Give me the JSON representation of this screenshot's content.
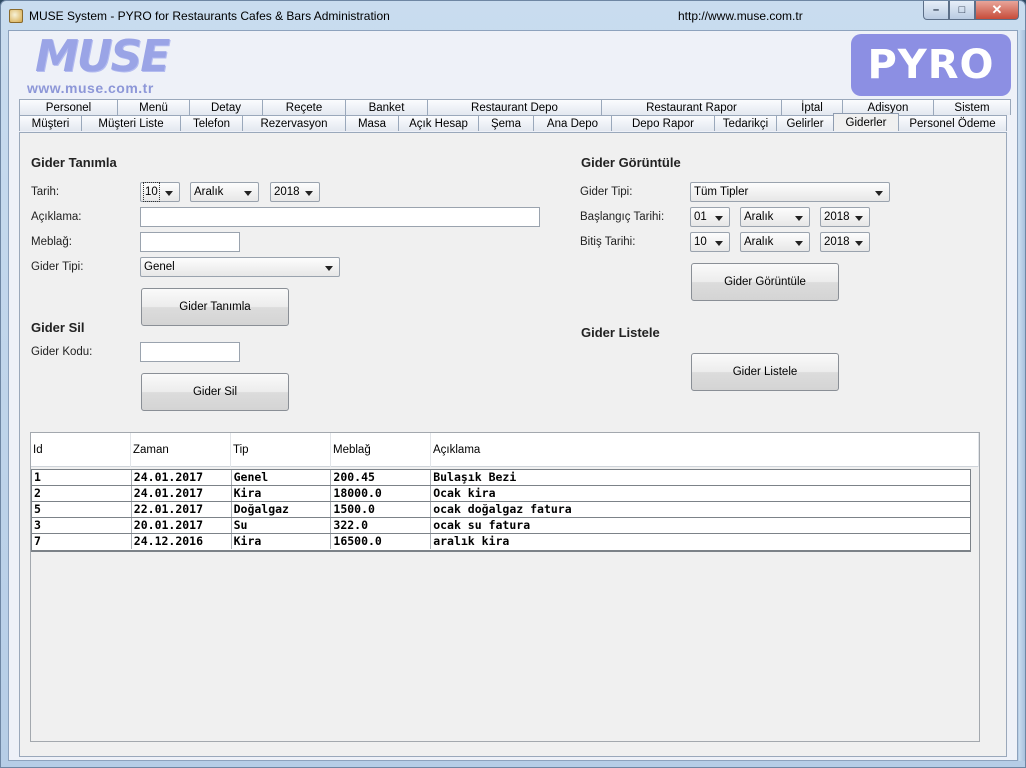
{
  "window": {
    "title": "MUSE System - PYRO for Restaurants Cafes & Bars Administration",
    "url": "http://www.muse.com.tr",
    "controls": {
      "minimize": "–",
      "maximize": "□",
      "close": "✕"
    }
  },
  "header": {
    "muse_logo": "MUSE",
    "muse_url": "www.muse.com.tr",
    "pyro_logo": "PYRO"
  },
  "tabs": {
    "row1": [
      "Personel",
      "Menü",
      "Detay",
      "Reçete",
      "Banket",
      "Restaurant Depo",
      "Restaurant Rapor",
      "İptal",
      "Adisyon",
      "Sistem"
    ],
    "row2": [
      "Müşteri",
      "Müşteri Liste",
      "Telefon",
      "Rezervasyon",
      "Masa",
      "Açık Hesap",
      "Şema",
      "Ana Depo",
      "Depo Rapor",
      "Tedarikçi",
      "Gelirler",
      "Giderler",
      "Personel Ödeme"
    ],
    "selected": "Giderler"
  },
  "gider_tanimla": {
    "title": "Gider Tanımla",
    "tarih_label": "Tarih:",
    "tarih_day": "10",
    "tarih_month": "Aralık",
    "tarih_year": "2018",
    "aciklama_label": "Açıklama:",
    "aciklama_value": "",
    "meblag_label": "Meblağ:",
    "meblag_value": "",
    "gider_tipi_label": "Gider Tipi:",
    "gider_tipi_value": "Genel",
    "button": "Gider Tanımla"
  },
  "gider_sil": {
    "title": "Gider Sil",
    "kod_label": "Gider Kodu:",
    "kod_value": "",
    "button": "Gider Sil"
  },
  "gider_goruntule": {
    "title": "Gider Görüntüle",
    "tipi_label": "Gider Tipi:",
    "tipi_value": "Tüm Tipler",
    "baslangic_label": "Başlangıç Tarihi:",
    "baslangic_day": "01",
    "baslangic_month": "Aralık",
    "baslangic_year": "2018",
    "bitis_label": "Bitiş Tarihi:",
    "bitis_day": "10",
    "bitis_month": "Aralık",
    "bitis_year": "2018",
    "button": "Gider Görüntüle"
  },
  "gider_listele": {
    "title": "Gider Listele",
    "button": "Gider Listele"
  },
  "table": {
    "columns": [
      "Id",
      "Zaman",
      "Tip",
      "Meblağ",
      "Açıklama"
    ],
    "rows": [
      [
        "1",
        "24.01.2017",
        "Genel",
        "200.45",
        "Bulaşık Bezi"
      ],
      [
        "2",
        "24.01.2017",
        "Kira",
        "18000.0",
        "Ocak kira"
      ],
      [
        "5",
        "22.01.2017",
        "Doğalgaz",
        "1500.0",
        "ocak doğalgaz fatura"
      ],
      [
        "3",
        "20.01.2017",
        "Su",
        "322.0",
        "ocak su fatura"
      ],
      [
        "7",
        "24.12.2016",
        "Kira",
        "16500.0",
        "aralık kira"
      ]
    ]
  }
}
